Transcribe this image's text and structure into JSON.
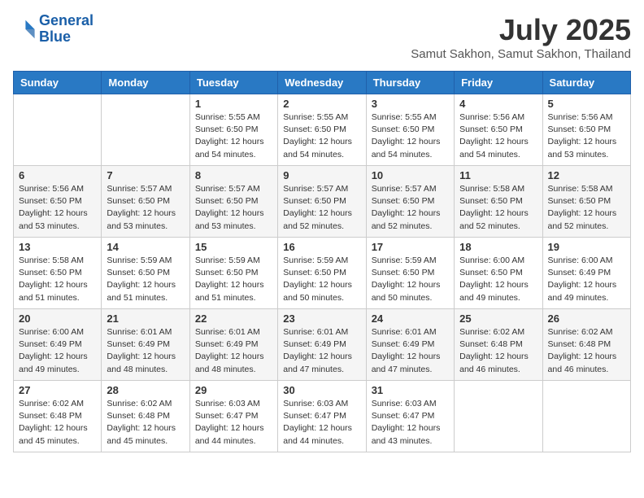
{
  "logo": {
    "line1": "General",
    "line2": "Blue"
  },
  "title": "July 2025",
  "location": "Samut Sakhon, Samut Sakhon, Thailand",
  "weekdays": [
    "Sunday",
    "Monday",
    "Tuesday",
    "Wednesday",
    "Thursday",
    "Friday",
    "Saturday"
  ],
  "weeks": [
    [
      {
        "day": "",
        "detail": ""
      },
      {
        "day": "",
        "detail": ""
      },
      {
        "day": "1",
        "detail": "Sunrise: 5:55 AM\nSunset: 6:50 PM\nDaylight: 12 hours\nand 54 minutes."
      },
      {
        "day": "2",
        "detail": "Sunrise: 5:55 AM\nSunset: 6:50 PM\nDaylight: 12 hours\nand 54 minutes."
      },
      {
        "day": "3",
        "detail": "Sunrise: 5:55 AM\nSunset: 6:50 PM\nDaylight: 12 hours\nand 54 minutes."
      },
      {
        "day": "4",
        "detail": "Sunrise: 5:56 AM\nSunset: 6:50 PM\nDaylight: 12 hours\nand 54 minutes."
      },
      {
        "day": "5",
        "detail": "Sunrise: 5:56 AM\nSunset: 6:50 PM\nDaylight: 12 hours\nand 53 minutes."
      }
    ],
    [
      {
        "day": "6",
        "detail": "Sunrise: 5:56 AM\nSunset: 6:50 PM\nDaylight: 12 hours\nand 53 minutes."
      },
      {
        "day": "7",
        "detail": "Sunrise: 5:57 AM\nSunset: 6:50 PM\nDaylight: 12 hours\nand 53 minutes."
      },
      {
        "day": "8",
        "detail": "Sunrise: 5:57 AM\nSunset: 6:50 PM\nDaylight: 12 hours\nand 53 minutes."
      },
      {
        "day": "9",
        "detail": "Sunrise: 5:57 AM\nSunset: 6:50 PM\nDaylight: 12 hours\nand 52 minutes."
      },
      {
        "day": "10",
        "detail": "Sunrise: 5:57 AM\nSunset: 6:50 PM\nDaylight: 12 hours\nand 52 minutes."
      },
      {
        "day": "11",
        "detail": "Sunrise: 5:58 AM\nSunset: 6:50 PM\nDaylight: 12 hours\nand 52 minutes."
      },
      {
        "day": "12",
        "detail": "Sunrise: 5:58 AM\nSunset: 6:50 PM\nDaylight: 12 hours\nand 52 minutes."
      }
    ],
    [
      {
        "day": "13",
        "detail": "Sunrise: 5:58 AM\nSunset: 6:50 PM\nDaylight: 12 hours\nand 51 minutes."
      },
      {
        "day": "14",
        "detail": "Sunrise: 5:59 AM\nSunset: 6:50 PM\nDaylight: 12 hours\nand 51 minutes."
      },
      {
        "day": "15",
        "detail": "Sunrise: 5:59 AM\nSunset: 6:50 PM\nDaylight: 12 hours\nand 51 minutes."
      },
      {
        "day": "16",
        "detail": "Sunrise: 5:59 AM\nSunset: 6:50 PM\nDaylight: 12 hours\nand 50 minutes."
      },
      {
        "day": "17",
        "detail": "Sunrise: 5:59 AM\nSunset: 6:50 PM\nDaylight: 12 hours\nand 50 minutes."
      },
      {
        "day": "18",
        "detail": "Sunrise: 6:00 AM\nSunset: 6:50 PM\nDaylight: 12 hours\nand 49 minutes."
      },
      {
        "day": "19",
        "detail": "Sunrise: 6:00 AM\nSunset: 6:49 PM\nDaylight: 12 hours\nand 49 minutes."
      }
    ],
    [
      {
        "day": "20",
        "detail": "Sunrise: 6:00 AM\nSunset: 6:49 PM\nDaylight: 12 hours\nand 49 minutes."
      },
      {
        "day": "21",
        "detail": "Sunrise: 6:01 AM\nSunset: 6:49 PM\nDaylight: 12 hours\nand 48 minutes."
      },
      {
        "day": "22",
        "detail": "Sunrise: 6:01 AM\nSunset: 6:49 PM\nDaylight: 12 hours\nand 48 minutes."
      },
      {
        "day": "23",
        "detail": "Sunrise: 6:01 AM\nSunset: 6:49 PM\nDaylight: 12 hours\nand 47 minutes."
      },
      {
        "day": "24",
        "detail": "Sunrise: 6:01 AM\nSunset: 6:49 PM\nDaylight: 12 hours\nand 47 minutes."
      },
      {
        "day": "25",
        "detail": "Sunrise: 6:02 AM\nSunset: 6:48 PM\nDaylight: 12 hours\nand 46 minutes."
      },
      {
        "day": "26",
        "detail": "Sunrise: 6:02 AM\nSunset: 6:48 PM\nDaylight: 12 hours\nand 46 minutes."
      }
    ],
    [
      {
        "day": "27",
        "detail": "Sunrise: 6:02 AM\nSunset: 6:48 PM\nDaylight: 12 hours\nand 45 minutes."
      },
      {
        "day": "28",
        "detail": "Sunrise: 6:02 AM\nSunset: 6:48 PM\nDaylight: 12 hours\nand 45 minutes."
      },
      {
        "day": "29",
        "detail": "Sunrise: 6:03 AM\nSunset: 6:47 PM\nDaylight: 12 hours\nand 44 minutes."
      },
      {
        "day": "30",
        "detail": "Sunrise: 6:03 AM\nSunset: 6:47 PM\nDaylight: 12 hours\nand 44 minutes."
      },
      {
        "day": "31",
        "detail": "Sunrise: 6:03 AM\nSunset: 6:47 PM\nDaylight: 12 hours\nand 43 minutes."
      },
      {
        "day": "",
        "detail": ""
      },
      {
        "day": "",
        "detail": ""
      }
    ]
  ]
}
